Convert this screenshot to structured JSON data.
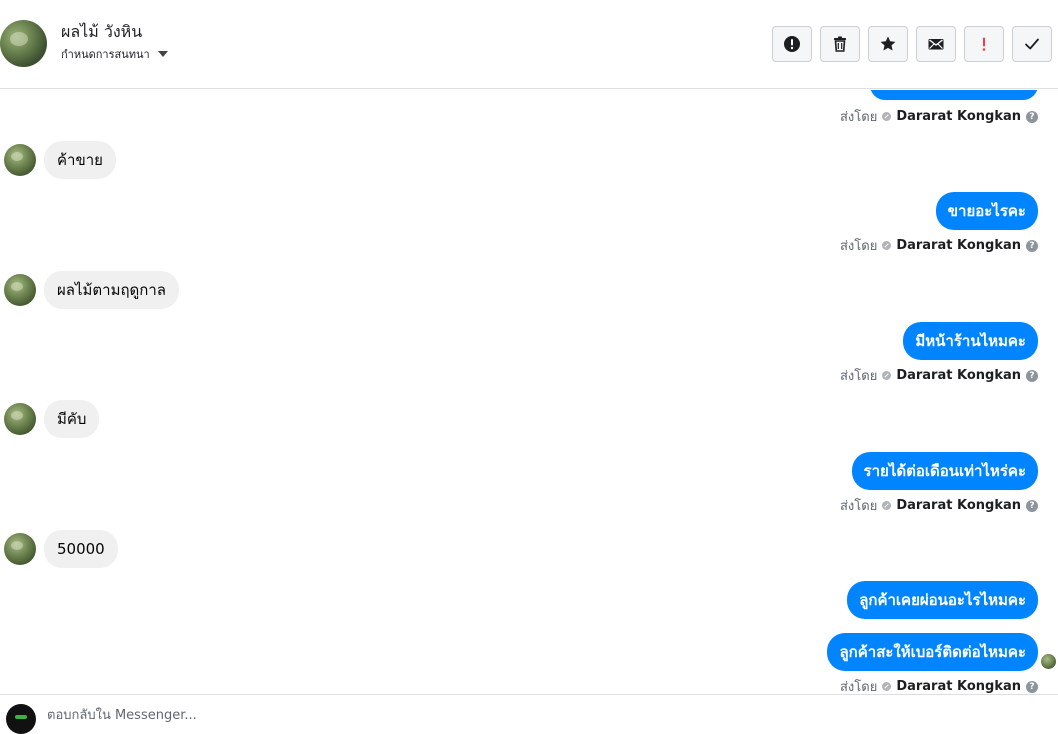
{
  "header": {
    "contact_name": "ผลไม้ วังหิน",
    "subtitle": "กำหนดการสนทนา",
    "toolbar": [
      {
        "name": "report-button",
        "icon": "alert-circle-icon"
      },
      {
        "name": "delete-button",
        "icon": "trash-icon"
      },
      {
        "name": "star-button",
        "icon": "star-icon"
      },
      {
        "name": "mark-unread-button",
        "icon": "envelope-icon"
      },
      {
        "name": "spam-button",
        "icon": "exclamation-icon"
      },
      {
        "name": "mark-done-button",
        "icon": "check-icon"
      }
    ]
  },
  "thread": {
    "sent_by_label": "ส่งโดย",
    "author": "Dararat Kongkan",
    "help_glyph": "?",
    "messages": [
      {
        "from": "contact",
        "text": "ค้าขาย"
      },
      {
        "from": "page",
        "text": "ขายอะไรคะ"
      },
      {
        "from": "contact",
        "text": "ผลไม้ตามฤดูกาล"
      },
      {
        "from": "page",
        "text": "มีหน้าร้านไหมคะ"
      },
      {
        "from": "contact",
        "text": "มีคับ"
      },
      {
        "from": "page",
        "text": "รายได้ต่อเดือนเท่าไหร่คะ"
      },
      {
        "from": "contact",
        "text": "50000"
      },
      {
        "from": "page",
        "text": "ลูกค้าเคยผ่อนอะไรไหมคะ"
      },
      {
        "from": "page",
        "text": "ลูกค้าสะให้เบอร์ติดต่อไหมคะ"
      }
    ]
  },
  "composer": {
    "placeholder": "ตอบกลับใน Messenger..."
  },
  "colors": {
    "outgoing_bubble": "#0084ff",
    "incoming_bubble": "#f0f0f0",
    "spam_icon": "#fa383e"
  }
}
